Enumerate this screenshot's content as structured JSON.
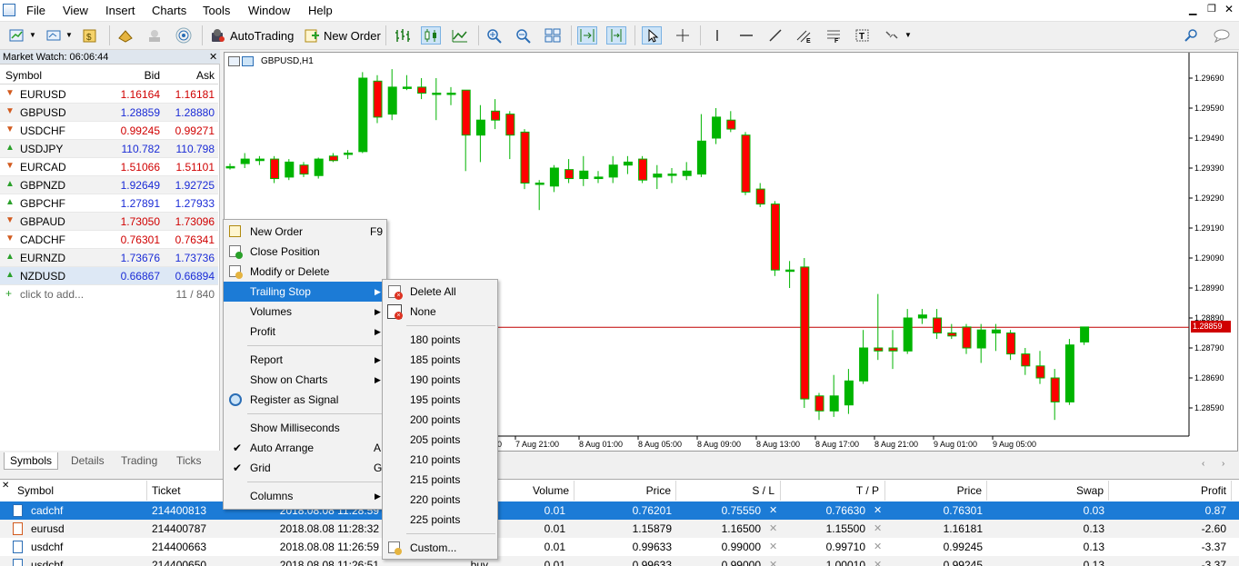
{
  "menubar": {
    "items": [
      "File",
      "View",
      "Insert",
      "Charts",
      "Tools",
      "Window",
      "Help"
    ]
  },
  "toolbar": {
    "autotrading_label": "AutoTrading",
    "new_order_label": "New Order"
  },
  "market_watch": {
    "title": "Market Watch: 06:06:44",
    "headers": {
      "symbol": "Symbol",
      "bid": "Bid",
      "ask": "Ask"
    },
    "rows": [
      {
        "symbol": "EURUSD",
        "bid": "1.16164",
        "ask": "1.16181",
        "dir": "down",
        "color": "red"
      },
      {
        "symbol": "GBPUSD",
        "bid": "1.28859",
        "ask": "1.28880",
        "dir": "down",
        "color": "blue"
      },
      {
        "symbol": "USDCHF",
        "bid": "0.99245",
        "ask": "0.99271",
        "dir": "down",
        "color": "red"
      },
      {
        "symbol": "USDJPY",
        "bid": "110.782",
        "ask": "110.798",
        "dir": "up",
        "color": "blue"
      },
      {
        "symbol": "EURCAD",
        "bid": "1.51066",
        "ask": "1.51101",
        "dir": "down",
        "color": "red"
      },
      {
        "symbol": "GBPNZD",
        "bid": "1.92649",
        "ask": "1.92725",
        "dir": "up",
        "color": "blue"
      },
      {
        "symbol": "GBPCHF",
        "bid": "1.27891",
        "ask": "1.27933",
        "dir": "up",
        "color": "blue"
      },
      {
        "symbol": "GBPAUD",
        "bid": "1.73050",
        "ask": "1.73096",
        "dir": "down",
        "color": "red"
      },
      {
        "symbol": "CADCHF",
        "bid": "0.76301",
        "ask": "0.76341",
        "dir": "down",
        "color": "red"
      },
      {
        "symbol": "EURNZD",
        "bid": "1.73676",
        "ask": "1.73736",
        "dir": "up",
        "color": "blue"
      },
      {
        "symbol": "NZDUSD",
        "bid": "0.66867",
        "ask": "0.66894",
        "dir": "up",
        "color": "blue"
      }
    ],
    "add_label": "click to add...",
    "count": "11 / 840",
    "tabs": [
      "Symbols",
      "Details",
      "Trading",
      "Ticks"
    ]
  },
  "chart": {
    "title": "GBPUSD,H1",
    "current_price": "1.28859",
    "y_ticks": [
      "1.29690",
      "1.29590",
      "1.29490",
      "1.29390",
      "1.29290",
      "1.29190",
      "1.29090",
      "1.28990",
      "1.28890",
      "1.28790",
      "1.28690",
      "1.28590"
    ],
    "x_ticks": [
      "0",
      "7 Aug 21:00",
      "8 Aug 01:00",
      "8 Aug 05:00",
      "8 Aug 09:00",
      "8 Aug 13:00",
      "8 Aug 17:00",
      "8 Aug 21:00",
      "9 Aug 01:00",
      "9 Aug 05:00"
    ]
  },
  "context_menu": {
    "items": [
      {
        "label": "New Order",
        "shortcut": "F9"
      },
      {
        "label": "Close Position"
      },
      {
        "label": "Modify or Delete"
      },
      {
        "label": "Trailing Stop"
      },
      {
        "label": "Volumes"
      },
      {
        "label": "Profit"
      },
      {
        "label": "Report"
      },
      {
        "label": "Show on Charts"
      },
      {
        "label": "Register as Signal"
      },
      {
        "label": "Show Milliseconds"
      },
      {
        "label": "Auto Arrange",
        "shortcut": "A"
      },
      {
        "label": "Grid",
        "shortcut": "G"
      },
      {
        "label": "Columns"
      }
    ]
  },
  "submenu": {
    "items": [
      "Delete All",
      "None",
      "180 points",
      "185 points",
      "190 points",
      "195 points",
      "200 points",
      "205 points",
      "210 points",
      "215 points",
      "220 points",
      "225 points",
      "Custom..."
    ]
  },
  "terminal": {
    "headers": [
      "Symbol",
      "Ticket",
      "",
      "Volume",
      "Price",
      "S / L",
      "T / P",
      "Price",
      "Swap",
      "Profit"
    ],
    "rows": [
      {
        "symbol": "cadchf",
        "ticket": "214400813",
        "time": "2018.08.08 11:28:59",
        "volume": "0.01",
        "price": "0.76201",
        "sl": "0.75550",
        "tp": "0.76630",
        "cur": "0.76301",
        "swap": "0.03",
        "profit": "0.87"
      },
      {
        "symbol": "eurusd",
        "ticket": "214400787",
        "time": "2018.08.08 11:28:32",
        "volume": "0.01",
        "price": "1.15879",
        "sl": "1.16500",
        "tp": "1.15500",
        "cur": "1.16181",
        "swap": "0.13",
        "profit": "-2.60"
      },
      {
        "symbol": "usdchf",
        "ticket": "214400663",
        "time": "2018.08.08 11:26:59",
        "volume": "0.01",
        "price": "0.99633",
        "sl": "0.99000",
        "tp": "0.99710",
        "cur": "0.99245",
        "swap": "0.13",
        "profit": "-3.37"
      },
      {
        "symbol": "usdchf",
        "ticket": "214400650",
        "time": "2018.08.08 11:26:51",
        "type": "buy",
        "volume": "0.01",
        "price": "0.99633",
        "sl": "0.99000",
        "tp": "1.00010",
        "cur": "0.99245",
        "swap": "0.13",
        "profit": "-3.37"
      }
    ]
  }
}
